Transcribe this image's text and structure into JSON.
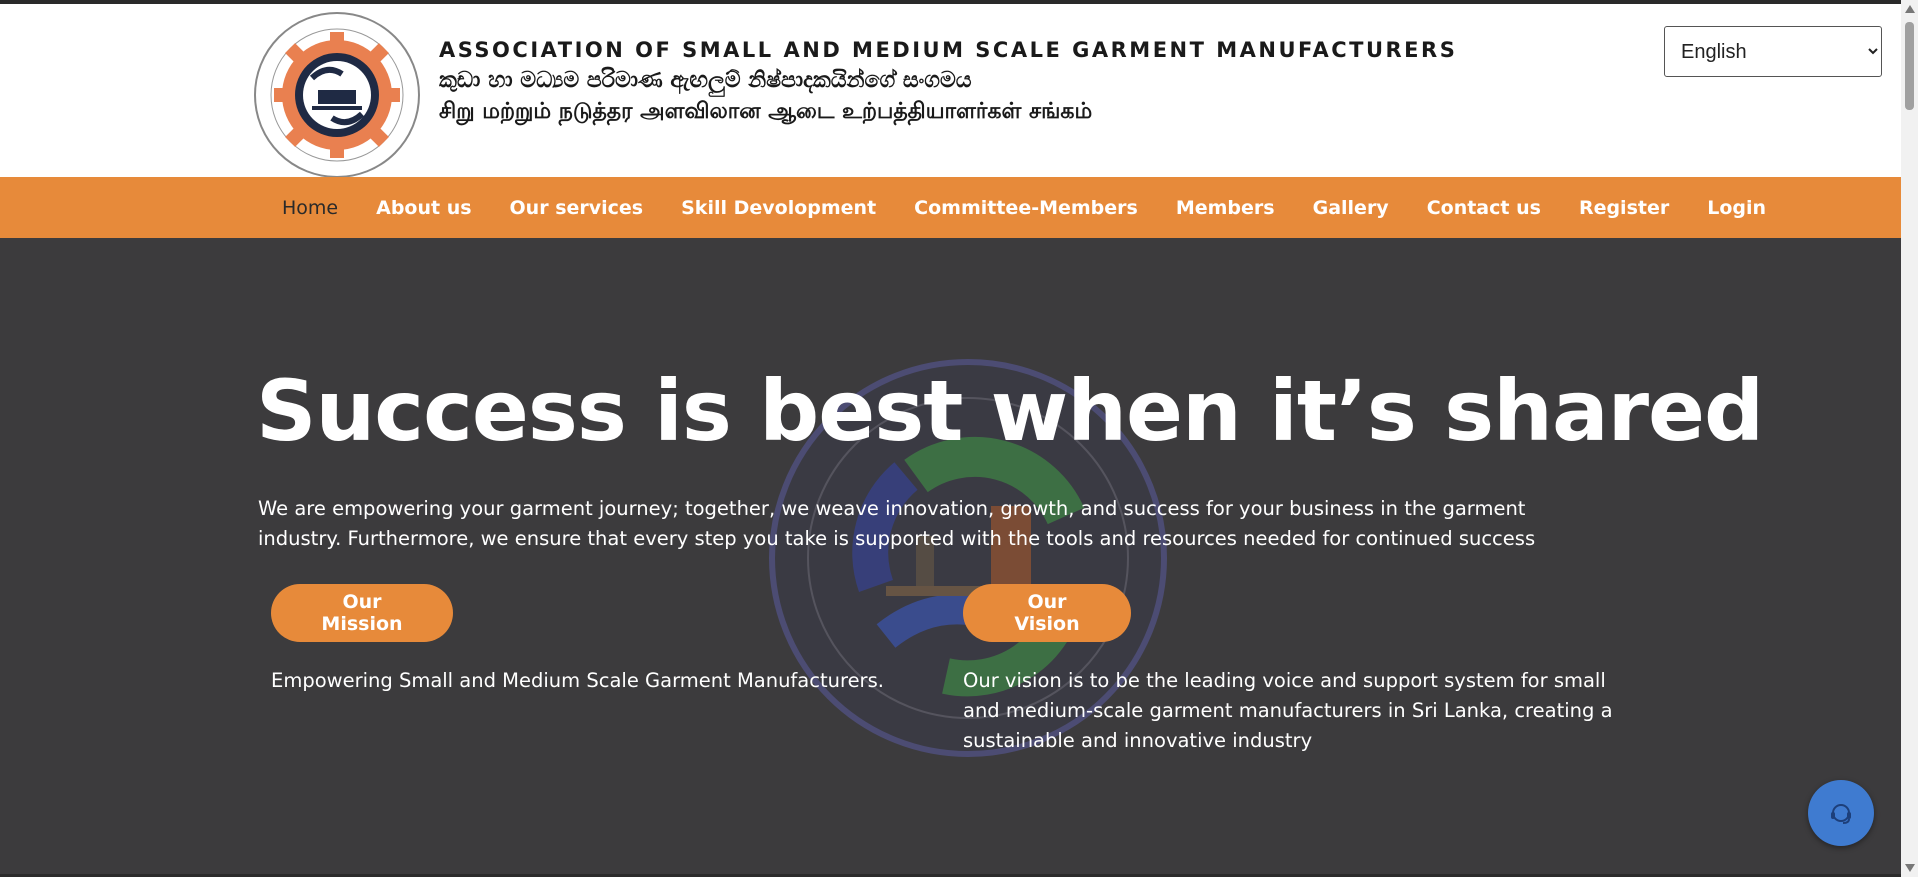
{
  "header": {
    "org_name_en": "ASSOCIATION OF SMALL AND MEDIUM SCALE GARMENT MANUFACTURERS",
    "org_name_si": "කුඩා හා මධ්‍යම පරිමාණ ඇඟලුම් නිෂ්පාදකයින්ගේ සංගමය",
    "org_name_ta": "சிறு மற்றும் நடுத்தர அளவிலான ஆடை உற்பத்தியாளர்கள் சங்கம்",
    "language_selected": "English",
    "logo_icon": "association-gear-sewing-logo"
  },
  "nav": {
    "items": [
      {
        "label": "Home",
        "active": true
      },
      {
        "label": "About us"
      },
      {
        "label": "Our services"
      },
      {
        "label": "Skill Devolopment"
      },
      {
        "label": "Committee-Members"
      },
      {
        "label": "Members"
      },
      {
        "label": "Gallery"
      },
      {
        "label": "Contact us"
      },
      {
        "label": "Register"
      },
      {
        "label": "Login"
      }
    ]
  },
  "hero": {
    "title": "Success is best when it’s shared",
    "description": "We are empowering your garment journey; together, we weave innovation, growth, and success for your business in the garment industry. Furthermore, we ensure that every step you take is supported with the tools and resources needed for continued success",
    "mission_button": "Our Mission",
    "mission_text": "Empowering Small and Medium Scale Garment Manufacturers.",
    "vision_button": "Our Vision",
    "vision_text": "Our vision is to be the leading voice and support system for small and medium-scale garment manufacturers in Sri Lanka, creating a sustainable and innovative industry"
  },
  "chat": {
    "icon": "support-headset-icon"
  },
  "colors": {
    "accent": "#e78a3a",
    "hero_bg": "#3c3b3d",
    "chat_bg": "#3f7bd0"
  }
}
